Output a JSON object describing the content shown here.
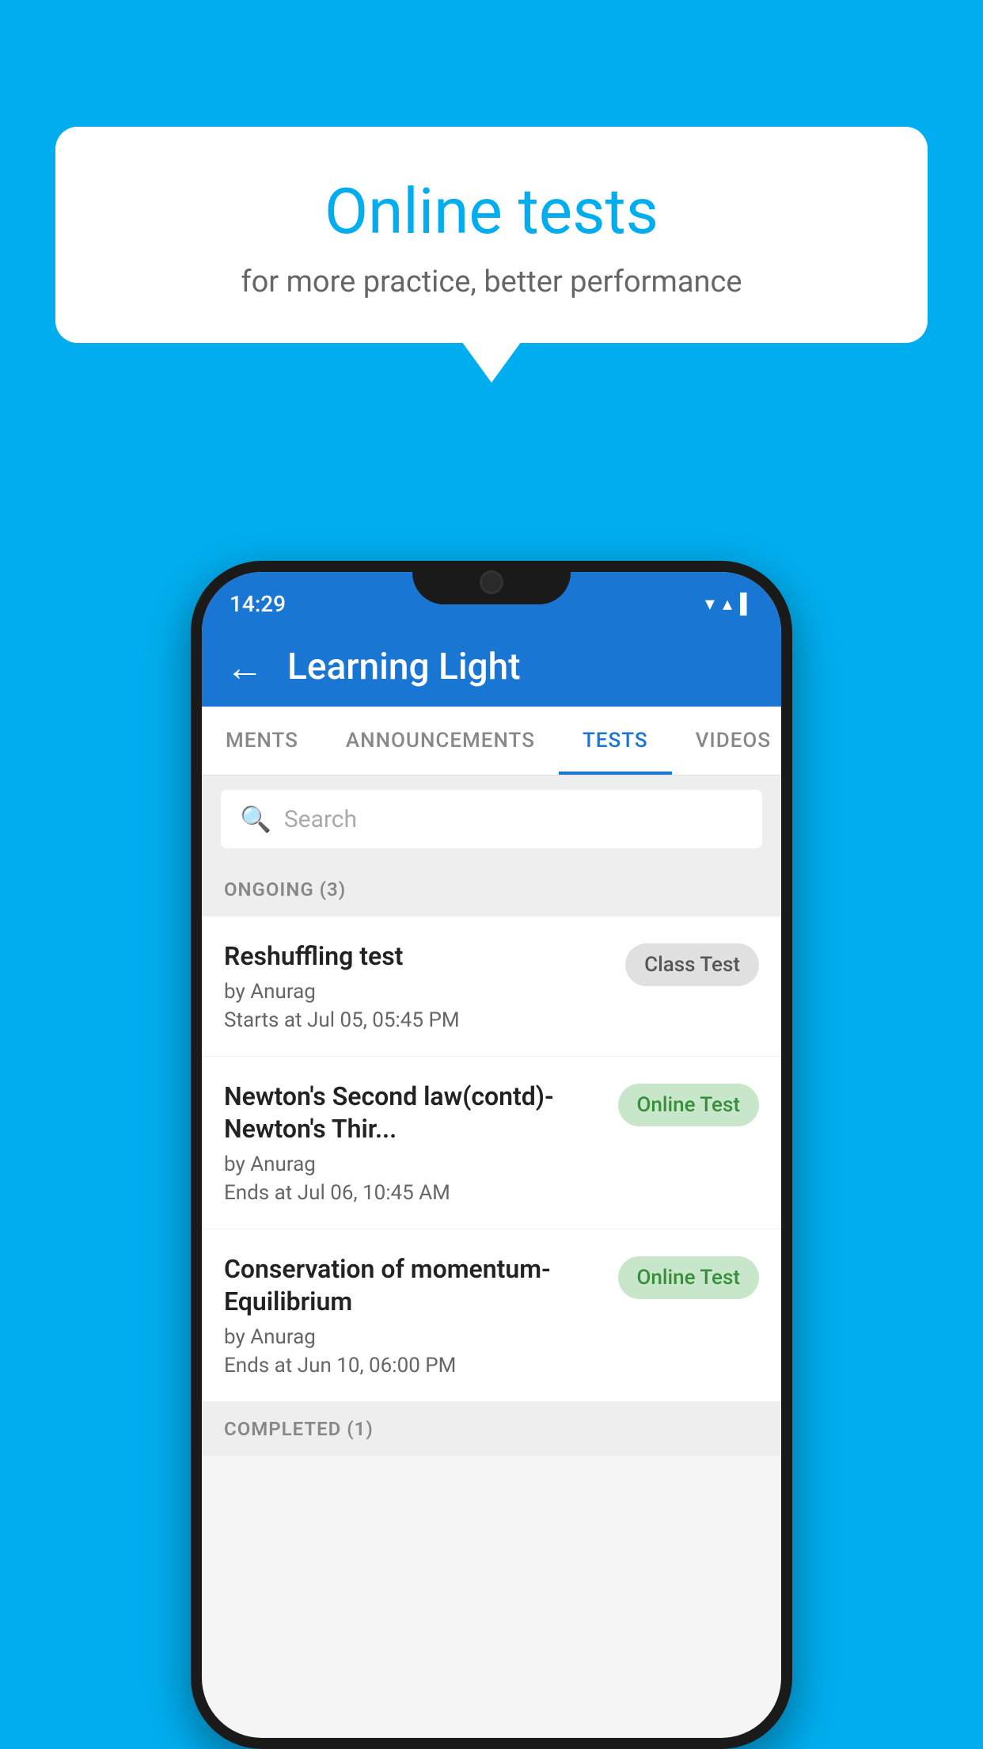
{
  "background_color": "#00AEEF",
  "bubble": {
    "title": "Online tests",
    "subtitle": "for more practice, better performance"
  },
  "phone": {
    "status_bar": {
      "time": "14:29",
      "icons": "▾ ▴ ▌"
    },
    "app_bar": {
      "back_label": "←",
      "title": "Learning Light"
    },
    "tabs": [
      {
        "label": "MENTS",
        "active": false
      },
      {
        "label": "ANNOUNCEMENTS",
        "active": false
      },
      {
        "label": "TESTS",
        "active": true
      },
      {
        "label": "VIDEOS",
        "active": false
      }
    ],
    "search": {
      "placeholder": "Search",
      "icon": "🔍"
    },
    "sections": [
      {
        "header": "ONGOING (3)",
        "items": [
          {
            "name": "Reshuffling test",
            "author": "by Anurag",
            "time_label": "Starts at",
            "time": "Jul 05, 05:45 PM",
            "badge": "Class Test",
            "badge_type": "class"
          },
          {
            "name": "Newton's Second law(contd)-Newton's Thir...",
            "author": "by Anurag",
            "time_label": "Ends at",
            "time": "Jul 06, 10:45 AM",
            "badge": "Online Test",
            "badge_type": "online"
          },
          {
            "name": "Conservation of momentum-Equilibrium",
            "author": "by Anurag",
            "time_label": "Ends at",
            "time": "Jun 10, 06:00 PM",
            "badge": "Online Test",
            "badge_type": "online"
          }
        ]
      },
      {
        "header": "COMPLETED (1)",
        "items": []
      }
    ]
  }
}
